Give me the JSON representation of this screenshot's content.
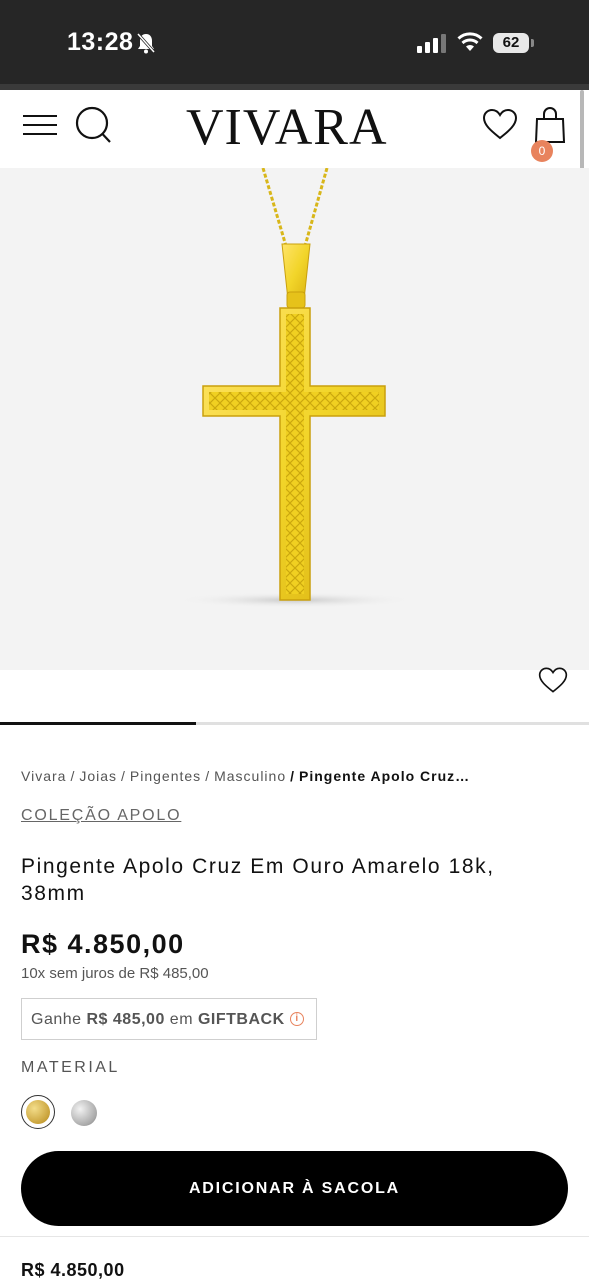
{
  "status_bar": {
    "time": "13:28",
    "battery": "62"
  },
  "header": {
    "logo": "VIVARA",
    "bag_count": "0"
  },
  "breadcrumb": {
    "items": [
      "Vivara",
      "Joias",
      "Pingentes",
      "Masculino"
    ],
    "separator": "/",
    "current": "Pingente Apolo Cruz…"
  },
  "product": {
    "collection": "COLEÇÃO APOLO",
    "title": "Pingente Apolo Cruz Em Ouro Amarelo 18k, 38mm",
    "price": "R$ 4.850,00",
    "installments": "10x sem juros de R$ 485,00",
    "giftback": {
      "prefix": "Ganhe",
      "amount": "R$ 485,00",
      "middle": "em",
      "label": "GIFTBACK",
      "info_icon": "i"
    },
    "material_label": "MATERIAL",
    "materials": [
      "gold",
      "silver"
    ],
    "gallery_progress": 0.333
  },
  "actions": {
    "add_to_bag": "ADICIONAR À SACOLA"
  },
  "sticky": {
    "price": "R$ 4.850,00"
  },
  "colors": {
    "accent": "#e8835d",
    "gold": "#f2d52a",
    "button": "#000000"
  },
  "icons": [
    "bell-off-icon",
    "signal-icon",
    "wifi-icon",
    "menu-icon",
    "search-icon",
    "heart-icon",
    "bag-icon",
    "info-icon"
  ]
}
